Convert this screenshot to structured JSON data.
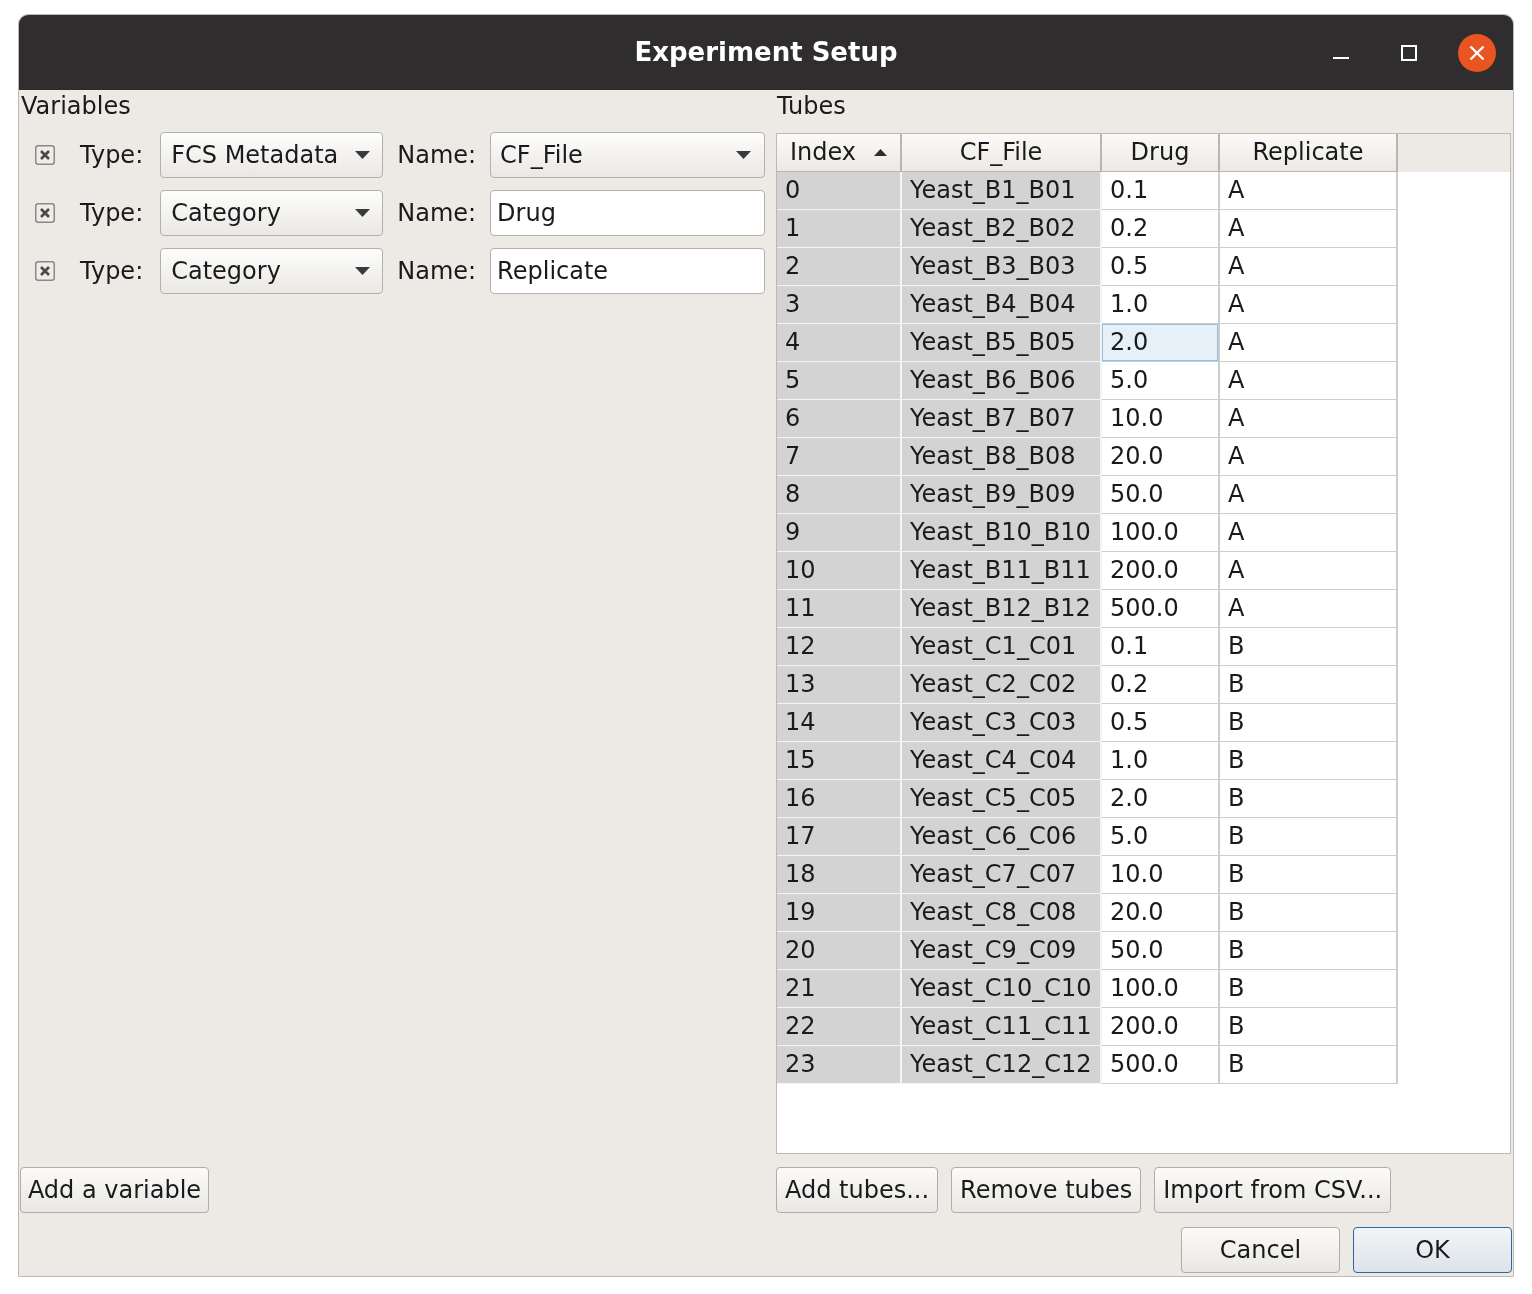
{
  "window": {
    "title": "Experiment Setup"
  },
  "variables": {
    "heading": "Variables",
    "rows": [
      {
        "type_label": "Type:",
        "type": "FCS Metadata",
        "name_label": "Name:",
        "name": "CF_File",
        "kind": "dropdown"
      },
      {
        "type_label": "Type:",
        "type": "Category",
        "name_label": "Name:",
        "name": "Drug",
        "kind": "text"
      },
      {
        "type_label": "Type:",
        "type": "Category",
        "name_label": "Name:",
        "name": "Replicate",
        "kind": "text"
      }
    ],
    "add_button": "Add a variable"
  },
  "tubes": {
    "heading": "Tubes",
    "table": {
      "columns": [
        {
          "label": "Index",
          "sorted": true,
          "editable": false
        },
        {
          "label": "CF_File",
          "sorted": false,
          "editable": false
        },
        {
          "label": "Drug",
          "sorted": false,
          "editable": true
        },
        {
          "label": "Replicate",
          "sorted": false,
          "editable": true
        }
      ],
      "rows": [
        {
          "cells": [
            {
              "text": "0",
              "selected": false
            },
            {
              "text": "Yeast_B1_B01",
              "selected": false
            },
            {
              "text": "0.1",
              "selected": false
            },
            {
              "text": "A",
              "selected": false
            }
          ]
        },
        {
          "cells": [
            {
              "text": "1",
              "selected": false
            },
            {
              "text": "Yeast_B2_B02",
              "selected": false
            },
            {
              "text": "0.2",
              "selected": false
            },
            {
              "text": "A",
              "selected": false
            }
          ]
        },
        {
          "cells": [
            {
              "text": "2",
              "selected": false
            },
            {
              "text": "Yeast_B3_B03",
              "selected": false
            },
            {
              "text": "0.5",
              "selected": false
            },
            {
              "text": "A",
              "selected": false
            }
          ]
        },
        {
          "cells": [
            {
              "text": "3",
              "selected": false
            },
            {
              "text": "Yeast_B4_B04",
              "selected": false
            },
            {
              "text": "1.0",
              "selected": false
            },
            {
              "text": "A",
              "selected": false
            }
          ]
        },
        {
          "cells": [
            {
              "text": "4",
              "selected": false
            },
            {
              "text": "Yeast_B5_B05",
              "selected": false
            },
            {
              "text": "2.0",
              "selected": true
            },
            {
              "text": "A",
              "selected": false
            }
          ]
        },
        {
          "cells": [
            {
              "text": "5",
              "selected": false
            },
            {
              "text": "Yeast_B6_B06",
              "selected": false
            },
            {
              "text": "5.0",
              "selected": false
            },
            {
              "text": "A",
              "selected": false
            }
          ]
        },
        {
          "cells": [
            {
              "text": "6",
              "selected": false
            },
            {
              "text": "Yeast_B7_B07",
              "selected": false
            },
            {
              "text": "10.0",
              "selected": false
            },
            {
              "text": "A",
              "selected": false
            }
          ]
        },
        {
          "cells": [
            {
              "text": "7",
              "selected": false
            },
            {
              "text": "Yeast_B8_B08",
              "selected": false
            },
            {
              "text": "20.0",
              "selected": false
            },
            {
              "text": "A",
              "selected": false
            }
          ]
        },
        {
          "cells": [
            {
              "text": "8",
              "selected": false
            },
            {
              "text": "Yeast_B9_B09",
              "selected": false
            },
            {
              "text": "50.0",
              "selected": false
            },
            {
              "text": "A",
              "selected": false
            }
          ]
        },
        {
          "cells": [
            {
              "text": "9",
              "selected": false
            },
            {
              "text": "Yeast_B10_B10",
              "selected": false
            },
            {
              "text": "100.0",
              "selected": false
            },
            {
              "text": "A",
              "selected": false
            }
          ]
        },
        {
          "cells": [
            {
              "text": "10",
              "selected": false
            },
            {
              "text": "Yeast_B11_B11",
              "selected": false
            },
            {
              "text": "200.0",
              "selected": false
            },
            {
              "text": "A",
              "selected": false
            }
          ]
        },
        {
          "cells": [
            {
              "text": "11",
              "selected": false
            },
            {
              "text": "Yeast_B12_B12",
              "selected": false
            },
            {
              "text": "500.0",
              "selected": false
            },
            {
              "text": "A",
              "selected": false
            }
          ]
        },
        {
          "cells": [
            {
              "text": "12",
              "selected": false
            },
            {
              "text": "Yeast_C1_C01",
              "selected": false
            },
            {
              "text": "0.1",
              "selected": false
            },
            {
              "text": "B",
              "selected": false
            }
          ]
        },
        {
          "cells": [
            {
              "text": "13",
              "selected": false
            },
            {
              "text": "Yeast_C2_C02",
              "selected": false
            },
            {
              "text": "0.2",
              "selected": false
            },
            {
              "text": "B",
              "selected": false
            }
          ]
        },
        {
          "cells": [
            {
              "text": "14",
              "selected": false
            },
            {
              "text": "Yeast_C3_C03",
              "selected": false
            },
            {
              "text": "0.5",
              "selected": false
            },
            {
              "text": "B",
              "selected": false
            }
          ]
        },
        {
          "cells": [
            {
              "text": "15",
              "selected": false
            },
            {
              "text": "Yeast_C4_C04",
              "selected": false
            },
            {
              "text": "1.0",
              "selected": false
            },
            {
              "text": "B",
              "selected": false
            }
          ]
        },
        {
          "cells": [
            {
              "text": "16",
              "selected": false
            },
            {
              "text": "Yeast_C5_C05",
              "selected": false
            },
            {
              "text": "2.0",
              "selected": false
            },
            {
              "text": "B",
              "selected": false
            }
          ]
        },
        {
          "cells": [
            {
              "text": "17",
              "selected": false
            },
            {
              "text": "Yeast_C6_C06",
              "selected": false
            },
            {
              "text": "5.0",
              "selected": false
            },
            {
              "text": "B",
              "selected": false
            }
          ]
        },
        {
          "cells": [
            {
              "text": "18",
              "selected": false
            },
            {
              "text": "Yeast_C7_C07",
              "selected": false
            },
            {
              "text": "10.0",
              "selected": false
            },
            {
              "text": "B",
              "selected": false
            }
          ]
        },
        {
          "cells": [
            {
              "text": "19",
              "selected": false
            },
            {
              "text": "Yeast_C8_C08",
              "selected": false
            },
            {
              "text": "20.0",
              "selected": false
            },
            {
              "text": "B",
              "selected": false
            }
          ]
        },
        {
          "cells": [
            {
              "text": "20",
              "selected": false
            },
            {
              "text": "Yeast_C9_C09",
              "selected": false
            },
            {
              "text": "50.0",
              "selected": false
            },
            {
              "text": "B",
              "selected": false
            }
          ]
        },
        {
          "cells": [
            {
              "text": "21",
              "selected": false
            },
            {
              "text": "Yeast_C10_C10",
              "selected": false
            },
            {
              "text": "100.0",
              "selected": false
            },
            {
              "text": "B",
              "selected": false
            }
          ]
        },
        {
          "cells": [
            {
              "text": "22",
              "selected": false
            },
            {
              "text": "Yeast_C11_C11",
              "selected": false
            },
            {
              "text": "200.0",
              "selected": false
            },
            {
              "text": "B",
              "selected": false
            }
          ]
        },
        {
          "cells": [
            {
              "text": "23",
              "selected": false
            },
            {
              "text": "Yeast_C12_C12",
              "selected": false
            },
            {
              "text": "500.0",
              "selected": false
            },
            {
              "text": "B",
              "selected": false
            }
          ]
        }
      ]
    },
    "buttons": [
      "Add tubes...",
      "Remove tubes",
      "Import from CSV..."
    ]
  },
  "dialog_buttons": [
    {
      "label": "Cancel",
      "default": false
    },
    {
      "label": "OK",
      "default": true
    }
  ]
}
